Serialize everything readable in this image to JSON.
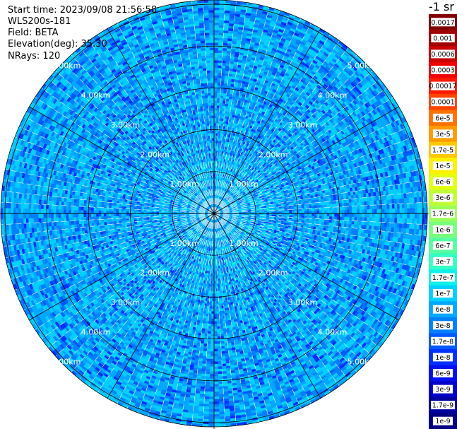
{
  "header": {
    "start_time": "Start time: 2023/09/08 21:56:58",
    "instrument": "WLS200s-181",
    "field": "Field: BETA",
    "elevation": "Elevation(deg): 35.30",
    "nrays": "NRays: 120"
  },
  "colorbar": {
    "unit_label": "-1 sr",
    "levels": [
      {
        "label": "0.0017",
        "color": "#800000"
      },
      {
        "label": "0.001",
        "color": "#a00000"
      },
      {
        "label": "0.0006",
        "color": "#c80000"
      },
      {
        "label": "0.0003",
        "color": "#ee0000"
      },
      {
        "label": "0.00017",
        "color": "#ff1a00"
      },
      {
        "label": "0.0001",
        "color": "#ff4400"
      },
      {
        "label": "6e-5",
        "color": "#ff7200"
      },
      {
        "label": "3e-5",
        "color": "#ff9c00"
      },
      {
        "label": "1.7e-5",
        "color": "#ffc800"
      },
      {
        "label": "1e-5",
        "color": "#fff000"
      },
      {
        "label": "6e-6",
        "color": "#e4ff10"
      },
      {
        "label": "3e-6",
        "color": "#c0ff36"
      },
      {
        "label": "1.7e-6",
        "color": "#9cff5a"
      },
      {
        "label": "1e-6",
        "color": "#78ff7e"
      },
      {
        "label": "6e-7",
        "color": "#56ffa0"
      },
      {
        "label": "3e-7",
        "color": "#34ffc4"
      },
      {
        "label": "1.7e-7",
        "color": "#10f0e8"
      },
      {
        "label": "1e-7",
        "color": "#00d0ff"
      },
      {
        "label": "6e-8",
        "color": "#00a8ff"
      },
      {
        "label": "3e-8",
        "color": "#0080ff"
      },
      {
        "label": "1.7e-8",
        "color": "#0058ff"
      },
      {
        "label": "1e-8",
        "color": "#0030ff"
      },
      {
        "label": "6e-9",
        "color": "#0010f0"
      },
      {
        "label": "3e-9",
        "color": "#0000c8"
      },
      {
        "label": "1.7e-9",
        "color": "#0000a0"
      },
      {
        "label": "1e-9",
        "color": "#000080"
      }
    ]
  },
  "chart_data": {
    "type": "heatmap",
    "projection": "polar PPI",
    "field": "BETA",
    "elevation_deg": 35.3,
    "n_rays": 120,
    "max_range_km": 5.1,
    "range_rings_km": [
      1.0,
      2.0,
      3.0,
      4.0,
      5.0
    ],
    "ring_labels": [
      "1.00km",
      "2.00km",
      "3.00km",
      "4.00km",
      "5.00km"
    ],
    "spoke_interval_deg": 30,
    "dominant_values": [
      "1e-8",
      "1.7e-8",
      "3e-8",
      "6e-8",
      "1e-7"
    ],
    "colors": {
      "background": "#ffffff",
      "grid": "#000000",
      "ring_label": "#ffffff"
    }
  }
}
